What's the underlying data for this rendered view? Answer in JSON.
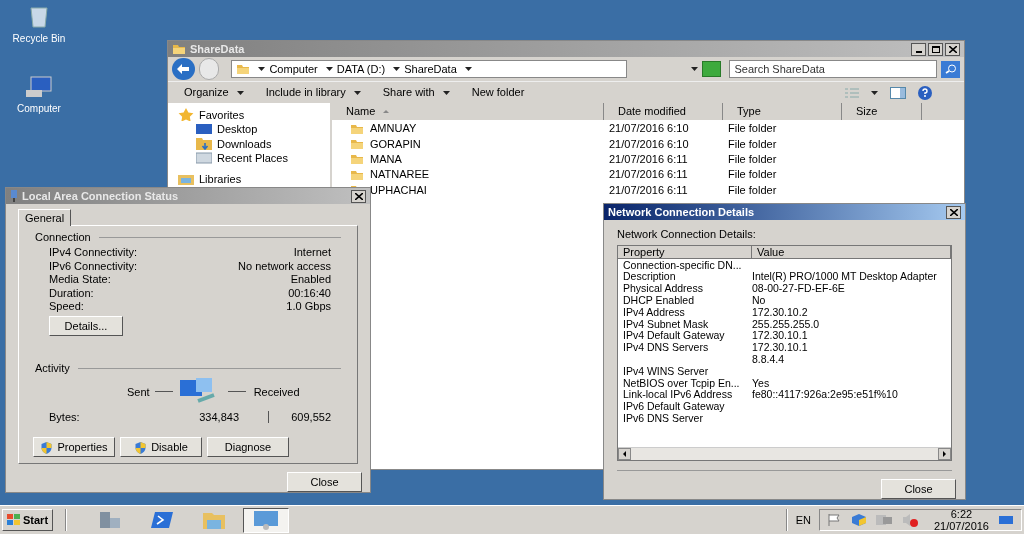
{
  "desktop_icons": [
    {
      "label": "Recycle Bin",
      "kind": "bin"
    },
    {
      "label": "Computer",
      "kind": "computer"
    }
  ],
  "explorer": {
    "title": "ShareData",
    "breadcrumb": [
      "Computer",
      "DATA (D:)",
      "ShareData"
    ],
    "search": {
      "placeholder": "Search ShareData"
    },
    "toolbar": [
      "Organize",
      "Include in library",
      "Share with",
      "New folder"
    ],
    "nav": [
      {
        "label": "Favorites",
        "kind": "favorites"
      },
      {
        "label": "Desktop",
        "kind": "desktop"
      },
      {
        "label": "Downloads",
        "kind": "downloads"
      },
      {
        "label": "Recent Places",
        "kind": "recent"
      },
      {
        "label": "Libraries",
        "kind": "libraries"
      }
    ],
    "columns": [
      "Name",
      "Date modified",
      "Type",
      "Size"
    ],
    "rows": [
      {
        "name": "AMNUAY",
        "date": "21/07/2016 6:10",
        "type": "File folder"
      },
      {
        "name": "GORAPIN",
        "date": "21/07/2016 6:10",
        "type": "File folder"
      },
      {
        "name": "MANA",
        "date": "21/07/2016 6:11",
        "type": "File folder"
      },
      {
        "name": "NATNAREE",
        "date": "21/07/2016 6:11",
        "type": "File folder"
      },
      {
        "name": "UPHACHAI",
        "date": "21/07/2016 6:11",
        "type": "File folder"
      }
    ]
  },
  "status_dialog": {
    "title": "Local Area Connection Status",
    "tabs": [
      {
        "label": "General",
        "selected": true
      }
    ],
    "connection_heading": "Connection",
    "fields": [
      {
        "label": "IPv4 Connectivity:",
        "value": "Internet"
      },
      {
        "label": "IPv6 Connectivity:",
        "value": "No network access"
      },
      {
        "label": "Media State:",
        "value": "Enabled"
      },
      {
        "label": "Duration:",
        "value": "00:16:40"
      },
      {
        "label": "Speed:",
        "value": "1.0 Gbps"
      }
    ],
    "details_button": "Details...",
    "activity_heading": "Activity",
    "sent_label": "Sent",
    "received_label": "Received",
    "bytes_label": "Bytes:",
    "sent": "334,843",
    "received": "609,552",
    "buttons": [
      {
        "label": "Properties",
        "shield": true
      },
      {
        "label": "Disable",
        "shield": true
      },
      {
        "label": "Diagnose",
        "shield": false
      }
    ],
    "close": "Close"
  },
  "details_dialog": {
    "title": "Network Connection Details",
    "caption": "Network Connection Details:",
    "columns": [
      "Property",
      "Value"
    ],
    "rows": [
      {
        "property": "Connection-specific DN..."
      },
      {
        "property": "Description",
        "value": "Intel(R) PRO/1000 MT Desktop Adapter"
      },
      {
        "property": "Physical Address",
        "value": "08-00-27-FD-EF-6E"
      },
      {
        "property": "DHCP Enabled",
        "value": "No"
      },
      {
        "property": "IPv4 Address",
        "value": "172.30.10.2"
      },
      {
        "property": "IPv4 Subnet Mask",
        "value": "255.255.255.0"
      },
      {
        "property": "IPv4 Default Gateway",
        "value": "172.30.10.1"
      },
      {
        "property": "IPv4 DNS Servers",
        "value": "172.30.10.1"
      },
      {
        "value": "8.8.4.4"
      },
      {
        "property": "IPv4 WINS Server"
      },
      {
        "property": "NetBIOS over Tcpip En...",
        "value": "Yes"
      },
      {
        "property": "Link-local IPv6 Address",
        "value": "fe80::4117:926a:2e95:e51f%10"
      },
      {
        "property": "IPv6 Default Gateway"
      },
      {
        "property": "IPv6 DNS Server"
      }
    ],
    "close": "Close"
  },
  "taskbar": {
    "start": "Start",
    "apps": [
      {
        "kind": "server",
        "selected": false
      },
      {
        "kind": "shell",
        "selected": false
      },
      {
        "kind": "folder",
        "selected": false
      },
      {
        "kind": "network",
        "selected": true
      }
    ],
    "language": "EN",
    "time": "6:22",
    "date": "21/07/2016"
  }
}
